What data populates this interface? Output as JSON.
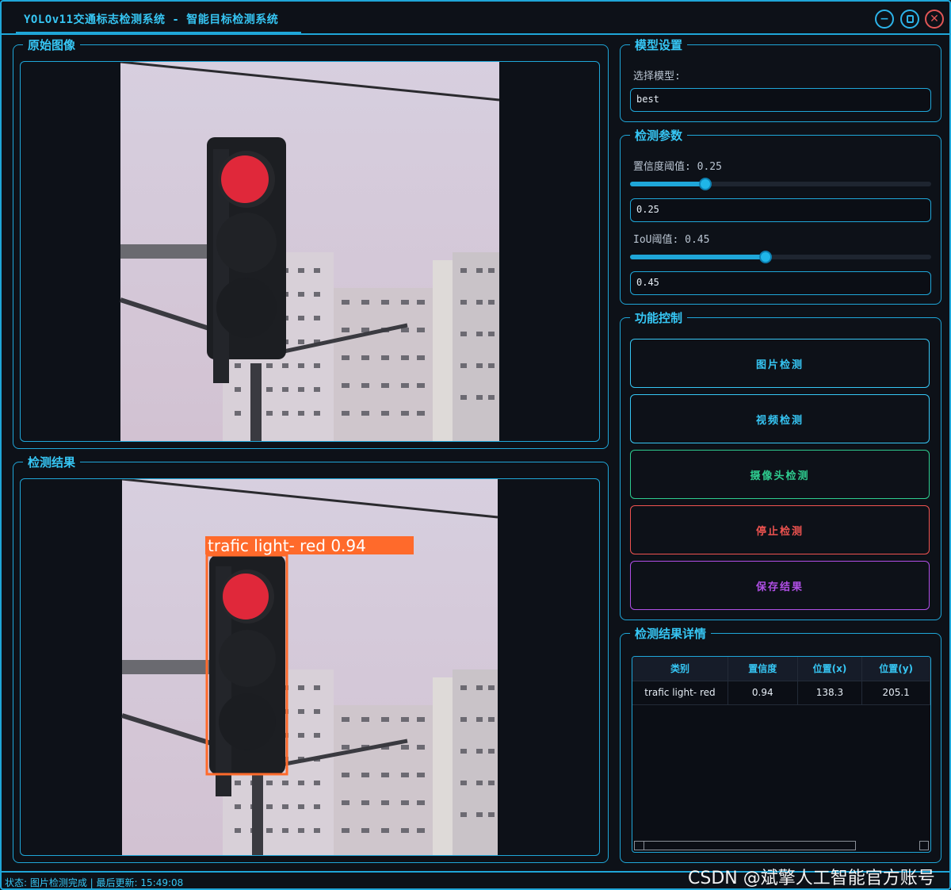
{
  "window": {
    "title": "YOLOv11交通标志检测系统 - 智能目标检测系统",
    "minimize_icon": "minimize-icon",
    "maximize_icon": "maximize-icon",
    "close_icon": "close-icon"
  },
  "original_panel": {
    "title": "原始图像"
  },
  "result_panel": {
    "title": "检测结果"
  },
  "model_settings": {
    "title": "模型设置",
    "select_label": "选择模型:",
    "selected_model": "best"
  },
  "params": {
    "title": "检测参数",
    "conf_label": "置信度阈值: 0.25",
    "conf_value": "0.25",
    "conf_level": 0.25,
    "iou_label": "IoU阈值: 0.45",
    "iou_value": "0.45",
    "iou_level": 0.45
  },
  "controls": {
    "title": "功能控制",
    "buttons": [
      {
        "label": "图片检测",
        "color": "#36c6f4"
      },
      {
        "label": "视频检测",
        "color": "#36c6f4"
      },
      {
        "label": "摄像头检测",
        "color": "#2ecc8f"
      },
      {
        "label": "停止检测",
        "color": "#ef5350"
      },
      {
        "label": "保存结果",
        "color": "#b04fe6"
      }
    ]
  },
  "details": {
    "title": "检测结果详情",
    "columns": [
      "类别",
      "置信度",
      "位置(x)",
      "位置(y)"
    ],
    "rows": [
      [
        "trafic light- red",
        "0.94",
        "138.3",
        "205.1"
      ]
    ]
  },
  "detection": {
    "label": "trafic light- red 0.94",
    "box_color": "#ff6a2b"
  },
  "status": {
    "text": "状态: 图片检测完成 | 最后更新: 15:49:08"
  },
  "watermark": "CSDN @斌擎人工智能官方账号"
}
